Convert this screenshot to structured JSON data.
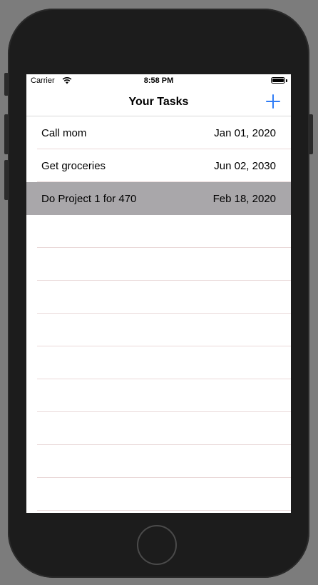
{
  "status_bar": {
    "carrier": "Carrier",
    "time": "8:58 PM",
    "wifi_icon": "wifi-icon",
    "battery_icon": "battery-icon"
  },
  "nav": {
    "title": "Your Tasks",
    "add_icon": "plus-icon",
    "accent_color": "#2f7cf6"
  },
  "tasks": [
    {
      "title": "Call mom",
      "date": "Jan 01, 2020",
      "selected": false
    },
    {
      "title": "Get groceries",
      "date": "Jun 02, 2030",
      "selected": false
    },
    {
      "title": "Do Project 1 for 470",
      "date": "Feb 18, 2020",
      "selected": true
    }
  ],
  "colors": {
    "selected_row": "#a9a7aa",
    "separator": "#ead9d9",
    "device_body": "#1c1c1c"
  }
}
